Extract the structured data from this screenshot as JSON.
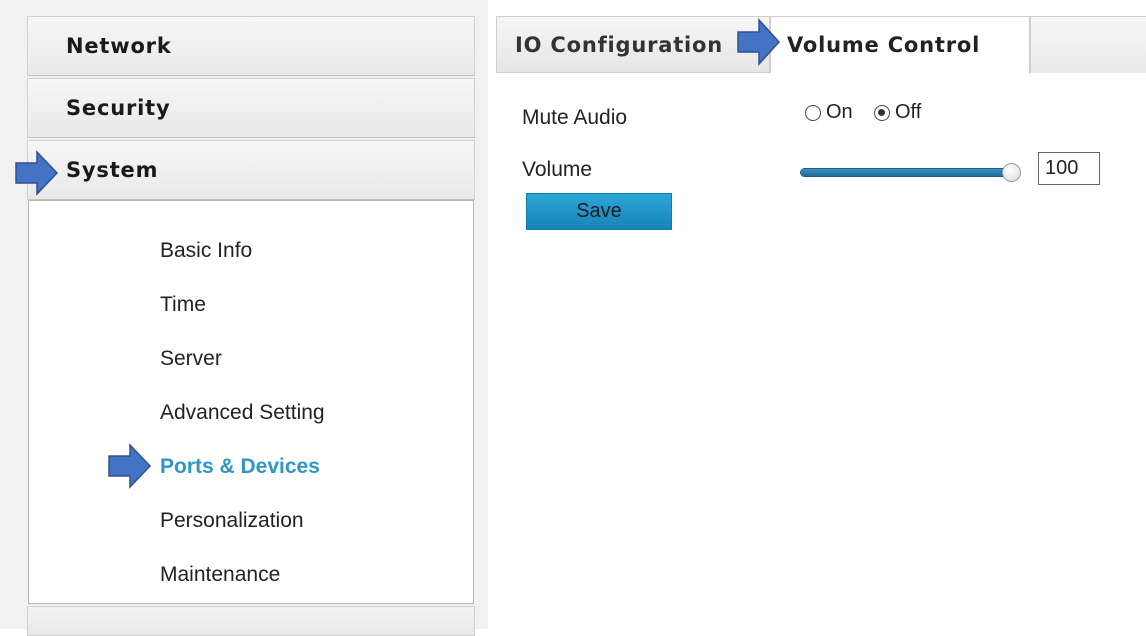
{
  "sidebar": {
    "sections": {
      "network": "Network",
      "security": "Security",
      "system": "System"
    },
    "system_items": [
      "Basic Info",
      "Time",
      "Server",
      "Advanced Setting",
      "Ports & Devices",
      "Personalization",
      "Maintenance"
    ],
    "active_item": "Ports & Devices"
  },
  "tabs": {
    "io": "IO Configuration",
    "volume": "Volume Control",
    "active": "Volume Control"
  },
  "form": {
    "mute_label": "Mute Audio",
    "mute_on": "On",
    "mute_off": "Off",
    "mute_selected": "Off",
    "volume_label": "Volume",
    "volume_value": "100",
    "volume_level": 1.0,
    "save_label": "Save"
  },
  "colors": {
    "accent": "#2e97c3",
    "arrow": "#4472c4",
    "save_button": "#1a94c8",
    "slider": "#2b7fb0"
  },
  "icons": {
    "annotation_arrow": "arrow-right-icon"
  }
}
